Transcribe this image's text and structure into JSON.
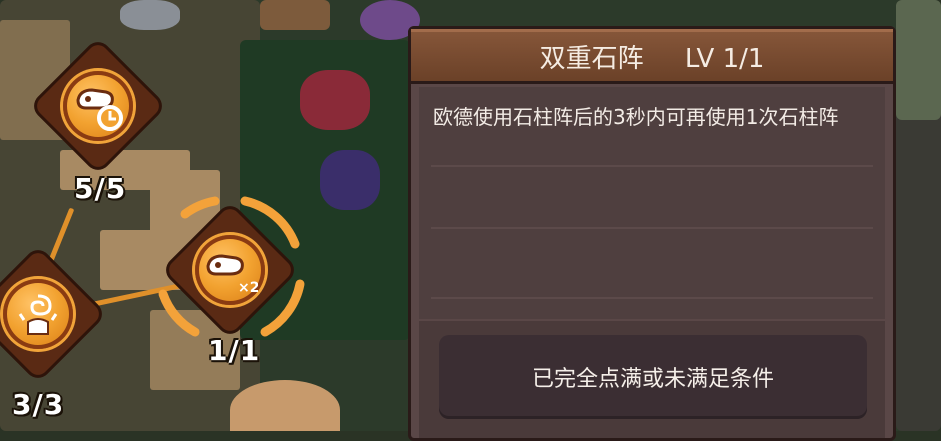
{
  "skill_tree": {
    "nodes": [
      {
        "id": "node-top",
        "icon": "fist-clock-icon",
        "count": "5/5"
      },
      {
        "id": "node-selected",
        "icon": "fist-x2-icon",
        "count": "1/1",
        "glyph_text": "×2"
      },
      {
        "id": "node-left",
        "icon": "spiral-pillar-icon",
        "count": "3/3"
      }
    ]
  },
  "panel": {
    "title": "双重石阵     LV 1/1",
    "description": "欧德使用石柱阵后的3秒内可再使用1次石柱阵",
    "action_label": "已完全点满或未满足条件"
  },
  "colors": {
    "node_orange": "#f2a230",
    "panel_bg": "#5a4747",
    "header_brown": "#7a4a30"
  }
}
